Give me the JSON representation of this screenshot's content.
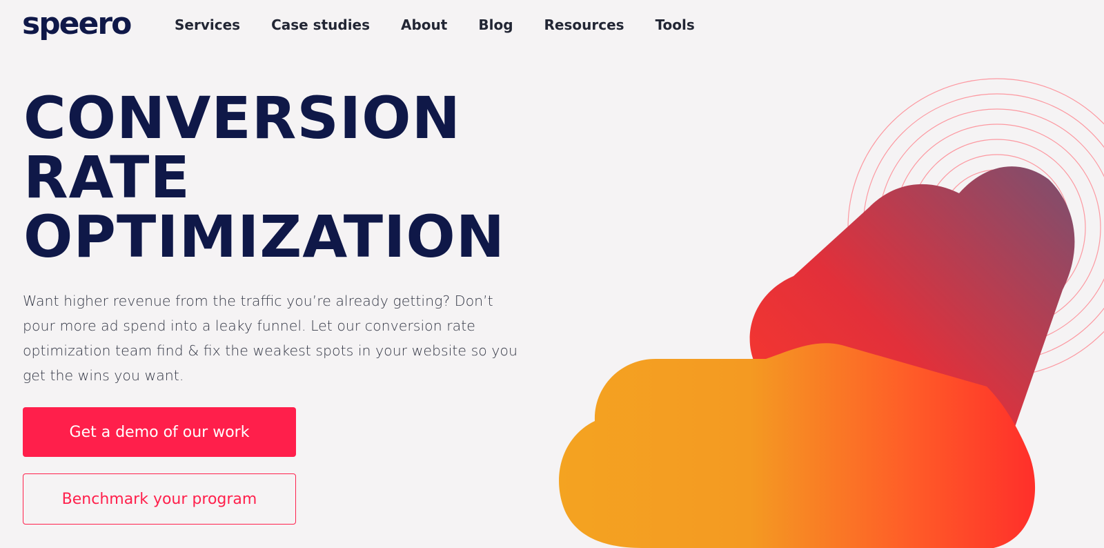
{
  "brand": {
    "logo_text": "speero"
  },
  "nav": {
    "items": [
      {
        "label": "Services"
      },
      {
        "label": "Case studies"
      },
      {
        "label": "About"
      },
      {
        "label": "Blog"
      },
      {
        "label": "Resources"
      },
      {
        "label": "Tools"
      }
    ]
  },
  "hero": {
    "title_lines": [
      "CONVERSION",
      "RATE",
      "OPTIMIZATION"
    ],
    "description": "Want higher revenue from the traffic you’re already getting? Don’t pour more ad spend into a leaky funnel. Let our conversion rate optimization team find & fix the weakest spots in your website so you get the wins you want.",
    "primary_cta": "Get a demo of our work",
    "secondary_cta": "Benchmark your program"
  },
  "colors": {
    "brand_navy": "#0f1848",
    "accent_red": "#ff1f4b",
    "background": "#f5f3f4",
    "art_orange": "#f4a321",
    "art_red": "#ff3a2a",
    "art_purple": "#7a5070"
  }
}
